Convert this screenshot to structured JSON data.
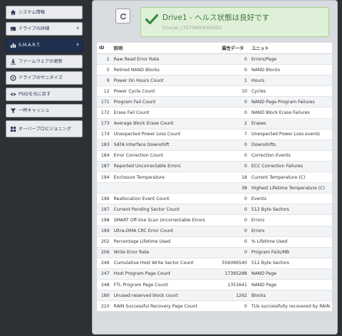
{
  "sidebar": {
    "items": [
      {
        "label": "システム情報",
        "icon": "home-icon",
        "chevron": false,
        "active": false
      },
      {
        "label": "ドライブの詳細",
        "icon": "drive-icon",
        "chevron": true,
        "active": false
      },
      {
        "label": "S.M.A.R.T.",
        "icon": "bar-chart-icon",
        "chevron": true,
        "active": true
      },
      {
        "label": "ファームウェアの更新",
        "icon": "download-icon",
        "chevron": false,
        "active": false
      },
      {
        "label": "ドライブのサニタイズ",
        "icon": "sanitize-icon",
        "chevron": false,
        "active": false
      },
      {
        "label": "PSIDを元に戻す",
        "icon": "eye-icon",
        "chevron": false,
        "active": false
      },
      {
        "label": "一時キャッシュ",
        "icon": "filter-icon",
        "chevron": false,
        "active": false
      },
      {
        "label": "オーバープロビジョニング",
        "icon": "grid-icon",
        "chevron": false,
        "active": false
      }
    ]
  },
  "status": {
    "title": "Drive1 - ヘルス状態は良好です",
    "subtitle": "Crucial_CT275MX300SSD1",
    "color": "#3c763d",
    "background": "#dff0d8"
  },
  "table": {
    "headers": {
      "id": "ID",
      "desc": "説明",
      "raw": "属性データ",
      "unit": "ユニット"
    },
    "rows": [
      {
        "id": "1",
        "desc": "Raw Read Error Rate",
        "raw": "0",
        "unit": "Errors/Page"
      },
      {
        "id": "5",
        "desc": "Retired NAND Blocks",
        "raw": "0",
        "unit": "NAND Blocks"
      },
      {
        "id": "9",
        "desc": "Power On Hours Count",
        "raw": "1",
        "unit": "Hours"
      },
      {
        "id": "12",
        "desc": "Power Cycle Count",
        "raw": "10",
        "unit": "Cycles"
      },
      {
        "id": "171",
        "desc": "Program Fail Count",
        "raw": "0",
        "unit": "NAND Page Program Failures"
      },
      {
        "id": "172",
        "desc": "Erase Fail Count",
        "raw": "0",
        "unit": "NAND Block Erase Failures"
      },
      {
        "id": "173",
        "desc": "Average Block Erase Count",
        "raw": "2",
        "unit": "Erases"
      },
      {
        "id": "174",
        "desc": "Unexpected Power Loss Count",
        "raw": "7",
        "unit": "Unexpected Power Loss events"
      },
      {
        "id": "183",
        "desc": "SATA Interface Downshift",
        "raw": "0",
        "unit": "Downshifts"
      },
      {
        "id": "184",
        "desc": "Error Correction Count",
        "raw": "0",
        "unit": "Correction Events"
      },
      {
        "id": "187",
        "desc": "Reported Uncorrectable Errors",
        "raw": "0",
        "unit": "ECC Correction Failures"
      },
      {
        "id": "194",
        "desc": "Enclosure Temperature",
        "raw": "18",
        "unit": "Current Temperature (C)"
      },
      {
        "id": "",
        "desc": "",
        "raw": "38",
        "unit": "Highest Lifetime Temperature (C)"
      },
      {
        "id": "196",
        "desc": "Reallocation Event Count",
        "raw": "0",
        "unit": "Events"
      },
      {
        "id": "197",
        "desc": "Current Pending Sector Count",
        "raw": "0",
        "unit": "512 Byte Sectors"
      },
      {
        "id": "198",
        "desc": "SMART Off-line Scan Uncorrectable Errors",
        "raw": "0",
        "unit": "Errors"
      },
      {
        "id": "199",
        "desc": "Ultra-DMA CRC Error Count",
        "raw": "0",
        "unit": "Errors"
      },
      {
        "id": "202",
        "desc": "Percentage Lifetime Used",
        "raw": "0",
        "unit": "% Lifetime Used"
      },
      {
        "id": "206",
        "desc": "Write Error Rate",
        "raw": "0",
        "unit": "Program Fails/MB"
      },
      {
        "id": "246",
        "desc": "Cumulative Host Write Sector Count",
        "raw": "556096540",
        "unit": "512 Byte Sectors"
      },
      {
        "id": "247",
        "desc": "Host Program Page Count",
        "raw": "17395288",
        "unit": "NAND Page"
      },
      {
        "id": "248",
        "desc": "FTL Program Page Count",
        "raw": "1351641",
        "unit": "NAND Page"
      },
      {
        "id": "180",
        "desc": "Unused reserved block count",
        "raw": "1262",
        "unit": "Blocks"
      },
      {
        "id": "210",
        "desc": "RAIN Successful Recovery Page Count",
        "raw": "0",
        "unit": "TUs successfully recovered by RAIN"
      }
    ]
  }
}
